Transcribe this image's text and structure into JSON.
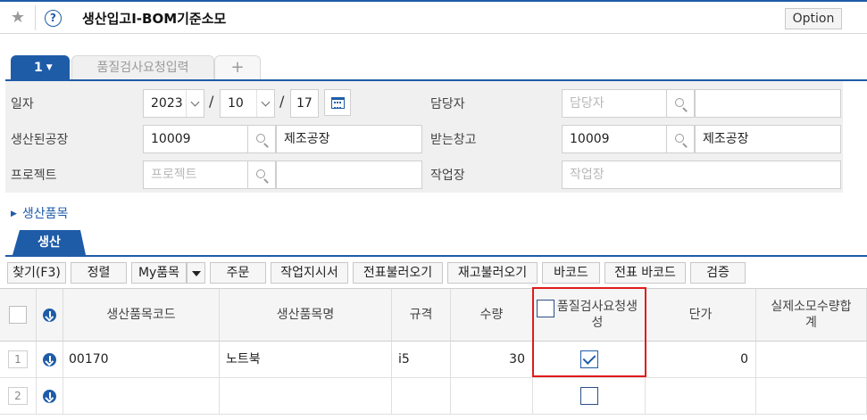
{
  "header": {
    "title": "생산입고I-BOM기준소모",
    "option_label": "Option"
  },
  "tabs": {
    "active_label": "1",
    "inactive_label": "품질검사요청입력",
    "add_label": "+"
  },
  "form": {
    "date_label": "일자",
    "date_year": "2023",
    "date_month": "10",
    "date_day": "17",
    "date_sep": "/",
    "manager_label": "담당자",
    "manager_placeholder": "담당자",
    "factory_label": "생산된공장",
    "factory_code": "10009",
    "factory_name": "제조공장",
    "warehouse_label": "받는창고",
    "warehouse_code": "10009",
    "warehouse_name": "제조공장",
    "project_label": "프로젝트",
    "project_placeholder": "프로젝트",
    "workplace_label": "작업장",
    "workplace_placeholder": "작업장"
  },
  "section": {
    "title": "생산품목"
  },
  "prod_tab": {
    "label": "생산"
  },
  "toolbar": {
    "find": "찾기(F3)",
    "sort": "정렬",
    "myitems": "My품목",
    "order": "주문",
    "workorder": "작업지시서",
    "load_slip": "전표불러오기",
    "load_stock": "재고불러오기",
    "barcode": "바코드",
    "slip_barcode": "전표 바코드",
    "verify": "검증"
  },
  "grid": {
    "headers": {
      "code": "생산품목코드",
      "name": "생산품목명",
      "spec": "규격",
      "qty": "수량",
      "qc": "품질검사요청생성",
      "price": "단가",
      "actual": "실제소모수량합계"
    },
    "rows": [
      {
        "num": "1",
        "code": "00170",
        "name": "노트북",
        "spec": "i5",
        "qty": "30",
        "qc_checked": true,
        "price": "0"
      },
      {
        "num": "2",
        "code": "",
        "name": "",
        "spec": "",
        "qty": "",
        "qc_checked": false,
        "price": ""
      }
    ]
  },
  "icons": {
    "favorite": "star-icon",
    "help": "help-icon",
    "search": "search-icon",
    "calendar": "calendar-icon",
    "download": "download-circle-icon"
  },
  "colors": {
    "accent": "#1e5ca8",
    "highlight": "#e01b1b"
  }
}
